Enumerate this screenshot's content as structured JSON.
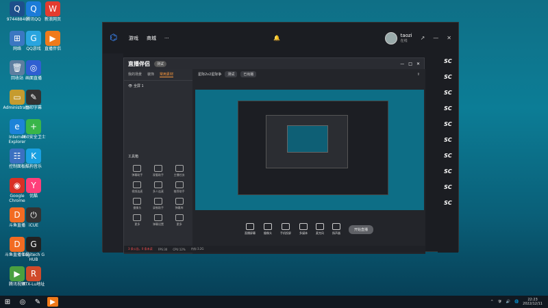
{
  "desktop": {
    "icons": [
      {
        "label": "97448840",
        "icon": "qq-icon",
        "color": "#1d4f8b"
      },
      {
        "label": "腾讯QQ",
        "icon": "qq-icon",
        "color": "#1b7bd8"
      },
      {
        "label": "新浪网页",
        "icon": "blog-icon",
        "color": "#e33b2f"
      },
      {
        "label": "网络",
        "icon": "network-icon",
        "color": "#3b77c2"
      },
      {
        "label": "QQ游戏",
        "icon": "game-icon",
        "color": "#2aa5df"
      },
      {
        "label": "直播伴侣",
        "icon": "live-icon",
        "color": "#f07a1a"
      },
      {
        "label": "回收站",
        "icon": "recycle-bin-icon",
        "color": "#5c7ea0"
      },
      {
        "label": "画面直播",
        "icon": "camera-icon",
        "color": "#2f5fd1"
      },
      {
        "label": "Administrator",
        "icon": "folder-icon",
        "color": "#c59b2f"
      },
      {
        "label": "豆印字幕",
        "icon": "pen-icon",
        "color": "#333"
      },
      {
        "label": "Internet Explorer",
        "icon": "ie-icon",
        "color": "#1d83d8"
      },
      {
        "label": "360安全卫士",
        "icon": "shield-icon",
        "color": "#39b54a"
      },
      {
        "label": "控制面板",
        "icon": "control-panel-icon",
        "color": "#3b70c1"
      },
      {
        "label": "酷狗音乐",
        "icon": "music-icon",
        "color": "#1aa0e1"
      },
      {
        "label": "Google Chrome",
        "icon": "chrome-icon",
        "color": "#d93025"
      },
      {
        "label": "优酷",
        "icon": "video-icon",
        "color": "#ff3f7a"
      },
      {
        "label": "斗鱼直播",
        "icon": "fish-icon",
        "color": "#f26b22"
      },
      {
        "label": "iCUE",
        "icon": "icue-icon",
        "color": "#333"
      },
      {
        "label": "斗鱼直播伴侣",
        "icon": "fish-icon",
        "color": "#f26b22"
      },
      {
        "label": "Logitech G HUB",
        "icon": "g-hub-icon",
        "color": "#222"
      },
      {
        "label": "腾讯视频",
        "icon": "play-icon",
        "color": "#4aa03f"
      },
      {
        "label": "RTX-Lu地址",
        "icon": "rtx-icon",
        "color": "#d04a2a"
      }
    ]
  },
  "taskbar": {
    "clock_time": "22:23",
    "clock_date": "2022/12/11"
  },
  "main_window": {
    "nav1": "游戏",
    "nav2": "商城",
    "user_name": "taozi",
    "status": "在线",
    "sc_label": "SC"
  },
  "obs": {
    "brand": "直播伴侣",
    "version": "测试",
    "tab1": "我的场景",
    "tab2": "装饰",
    "tab3": "常用素材",
    "scene_name": "全屏 1",
    "stream_title": "星际2v2星际争",
    "stream_badge": "测试",
    "cat_label": "已出版",
    "tools_title": "工具箱",
    "tools": [
      "弹幕助手",
      "观看助手",
      "主播任务",
      "视频连麦",
      "多人连麦",
      "推荐助手",
      "摄像头",
      "录制助手",
      "弹幕库",
      "更多",
      "弹幕设置",
      "更多"
    ],
    "controls": [
      "直播屏幕",
      "摄像头",
      "手机投屏",
      "多媒体",
      "麦克风",
      "扬声器"
    ],
    "start_live": "开始直播",
    "status_warn": "3 条公告，0 条未读",
    "status_fps": "FPS:30",
    "status_cpu": "CPU:12%",
    "status_mem": "内存:3.2G"
  }
}
